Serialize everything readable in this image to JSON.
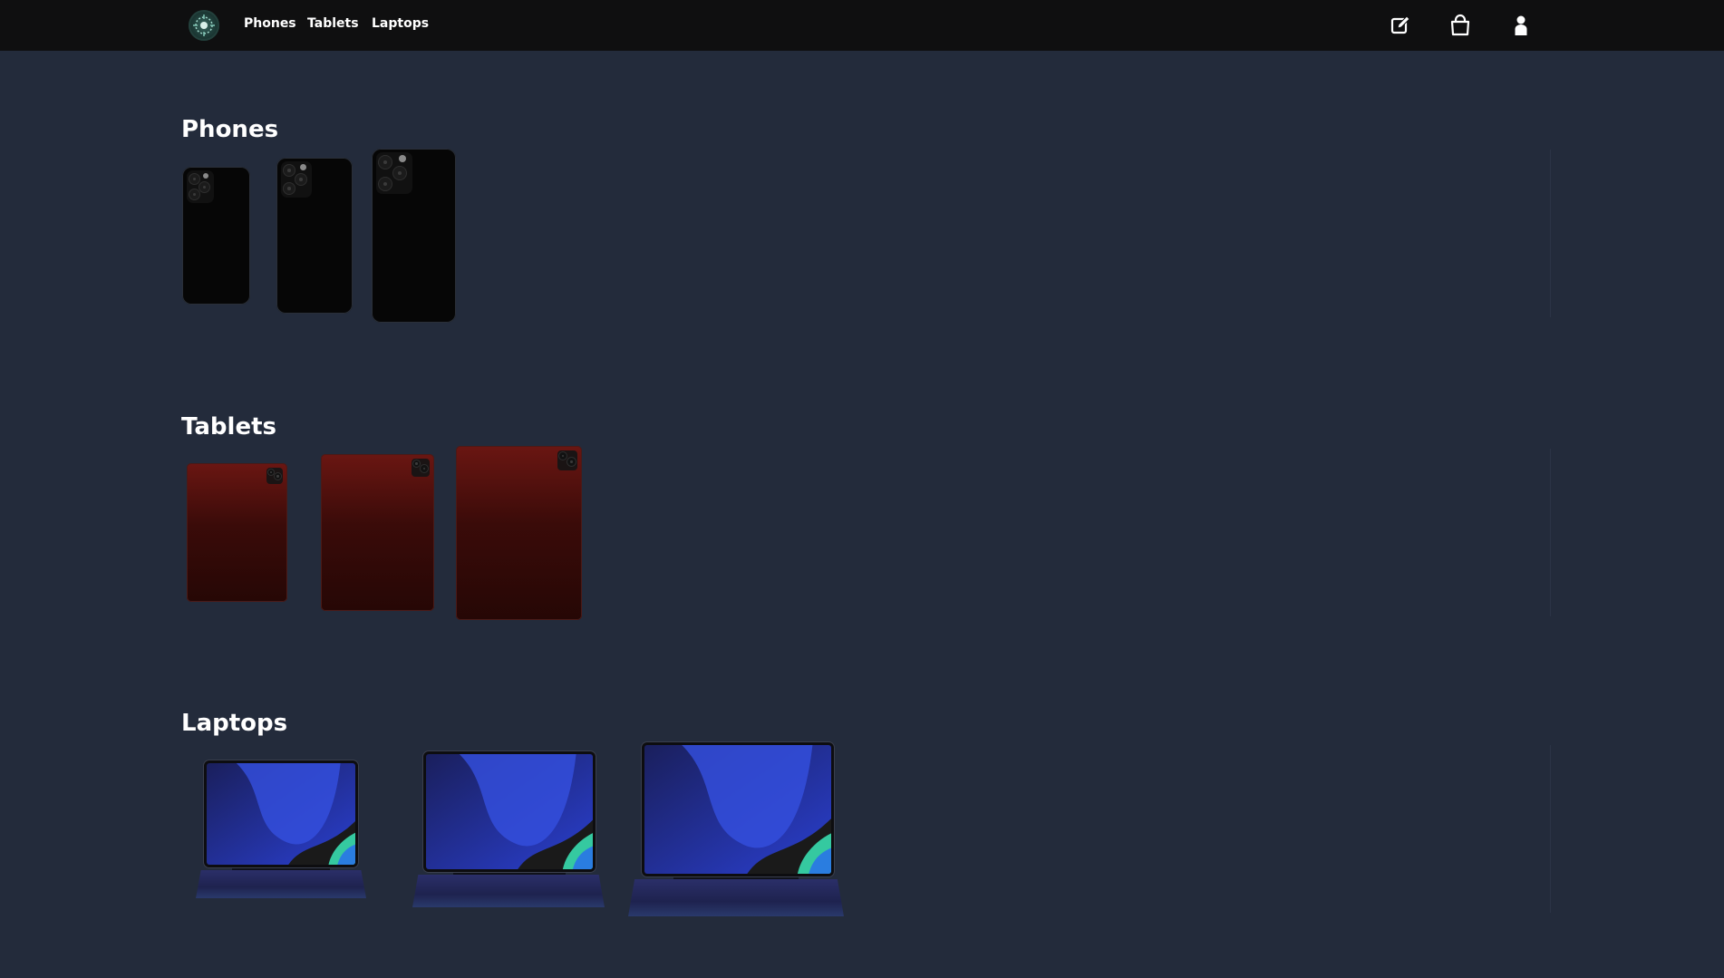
{
  "nav": {
    "logo": "brand-logo",
    "links": [
      {
        "label": "Phones"
      },
      {
        "label": "Tablets"
      },
      {
        "label": "Laptops"
      }
    ],
    "icons": [
      "edit-icon",
      "shopping-bag-icon",
      "user-icon"
    ]
  },
  "sections": {
    "phones": {
      "title": "Phones",
      "items": [
        "phone-small",
        "phone-medium",
        "phone-large"
      ]
    },
    "tablets": {
      "title": "Tablets",
      "items": [
        "tablet-small",
        "tablet-medium",
        "tablet-large"
      ]
    },
    "laptops": {
      "title": "Laptops",
      "items": [
        "laptop-small",
        "laptop-medium",
        "laptop-large"
      ]
    }
  },
  "colors": {
    "background": "#232b3b",
    "topbar": "#0f0f10",
    "tablet_red": "#6a1612",
    "phone_black": "#060606"
  }
}
